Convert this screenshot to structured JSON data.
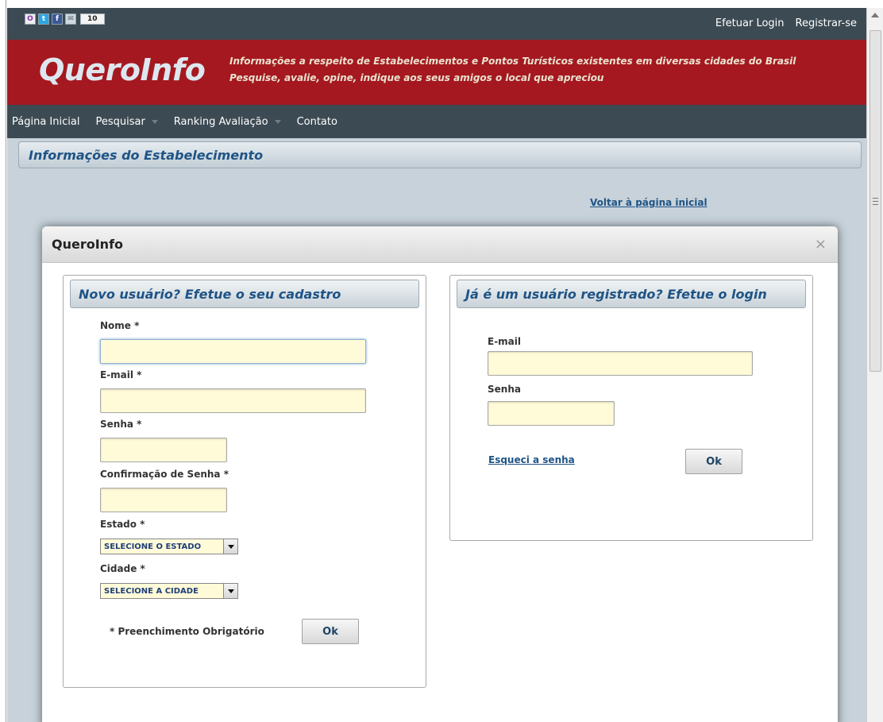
{
  "topbar": {
    "share_icons": [
      "orkut-icon",
      "twitter-icon",
      "facebook-icon",
      "mail-icon"
    ],
    "share_count": "10",
    "links": {
      "login": "Efetuar Login",
      "register": "Registrar-se"
    }
  },
  "header": {
    "logo": "QueroInfo",
    "tagline1": "Informações a respeito de Estabelecimentos e Pontos Turísticos existentes em diversas cidades do Brasil",
    "tagline2": "Pesquise, avalie, opine, indique aos seus amigos o local que apreciou"
  },
  "nav": {
    "items": [
      {
        "label": "Página Inicial"
      },
      {
        "label": "Pesquisar"
      },
      {
        "label": "Ranking Avaliação"
      },
      {
        "label": "Contato"
      }
    ]
  },
  "page": {
    "section_title": "Informações do Estabelecimento",
    "back_link": "Voltar à página inicial"
  },
  "modal": {
    "title": "QueroInfo",
    "close_symbol": "×",
    "register": {
      "title": "Novo usuário? Efetue o seu cadastro",
      "name_label": "Nome *",
      "email_label": "E-mail *",
      "password_label": "Senha *",
      "confirm_label": "Confirmação de Senha *",
      "state_label": "Estado *",
      "state_value": "SELECIONE O ESTADO",
      "city_label": "Cidade *",
      "city_value": "SELECIONE A CIDADE",
      "required_note": "* Preenchimento Obrigatório",
      "ok": "Ok"
    },
    "login": {
      "title": "Já é um usuário registrado? Efetue o login",
      "email_label": "E-mail",
      "password_label": "Senha",
      "forgot_link": "Esqueci a senha",
      "ok": "Ok"
    }
  },
  "colors": {
    "header_red": "#a51820",
    "nav_dark": "#3c4a53",
    "page_bg": "#c7d2da",
    "title_blue": "#1f5486",
    "field_yellow": "#fffbd8"
  }
}
